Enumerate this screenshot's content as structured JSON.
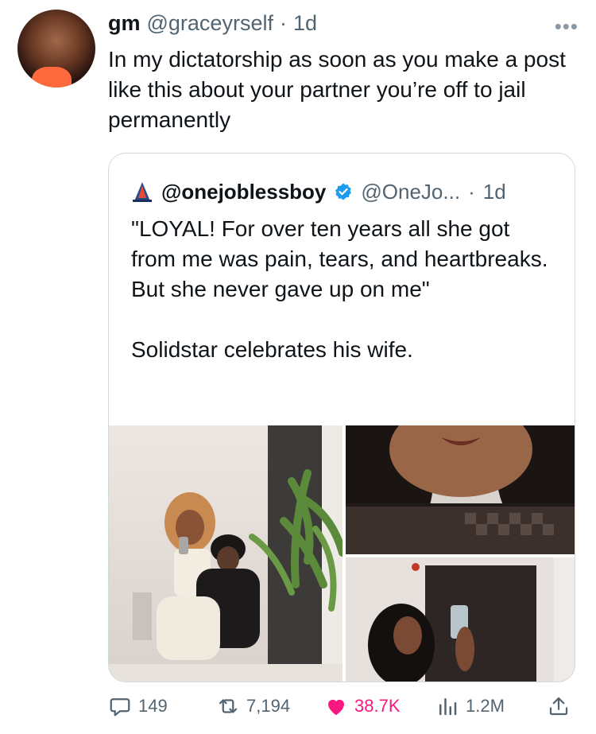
{
  "tweet": {
    "display_name": "gm",
    "handle": "@graceyrself",
    "separator": "·",
    "time": "1d",
    "text": "In my dictatorship as soon as you make a post like this about your partner you’re off to jail permanently"
  },
  "quote": {
    "display_name": "@onejoblessboy",
    "handle": "@OneJo...",
    "separator": "·",
    "time": "1d",
    "paragraph_1": "\"LOYAL! For over ten years all she got from me was pain, tears, and heartbreaks. But she never gave up on me\"",
    "paragraph_2": "Solidstar celebrates his wife."
  },
  "actions": {
    "replies": "149",
    "retweets": "7,194",
    "likes": "38.7K",
    "views": "1.2M"
  },
  "colors": {
    "text": "#0f1419",
    "muted": "#536471",
    "like": "#f91880",
    "verified": "#1d9bf0",
    "border": "#cfd9de"
  }
}
